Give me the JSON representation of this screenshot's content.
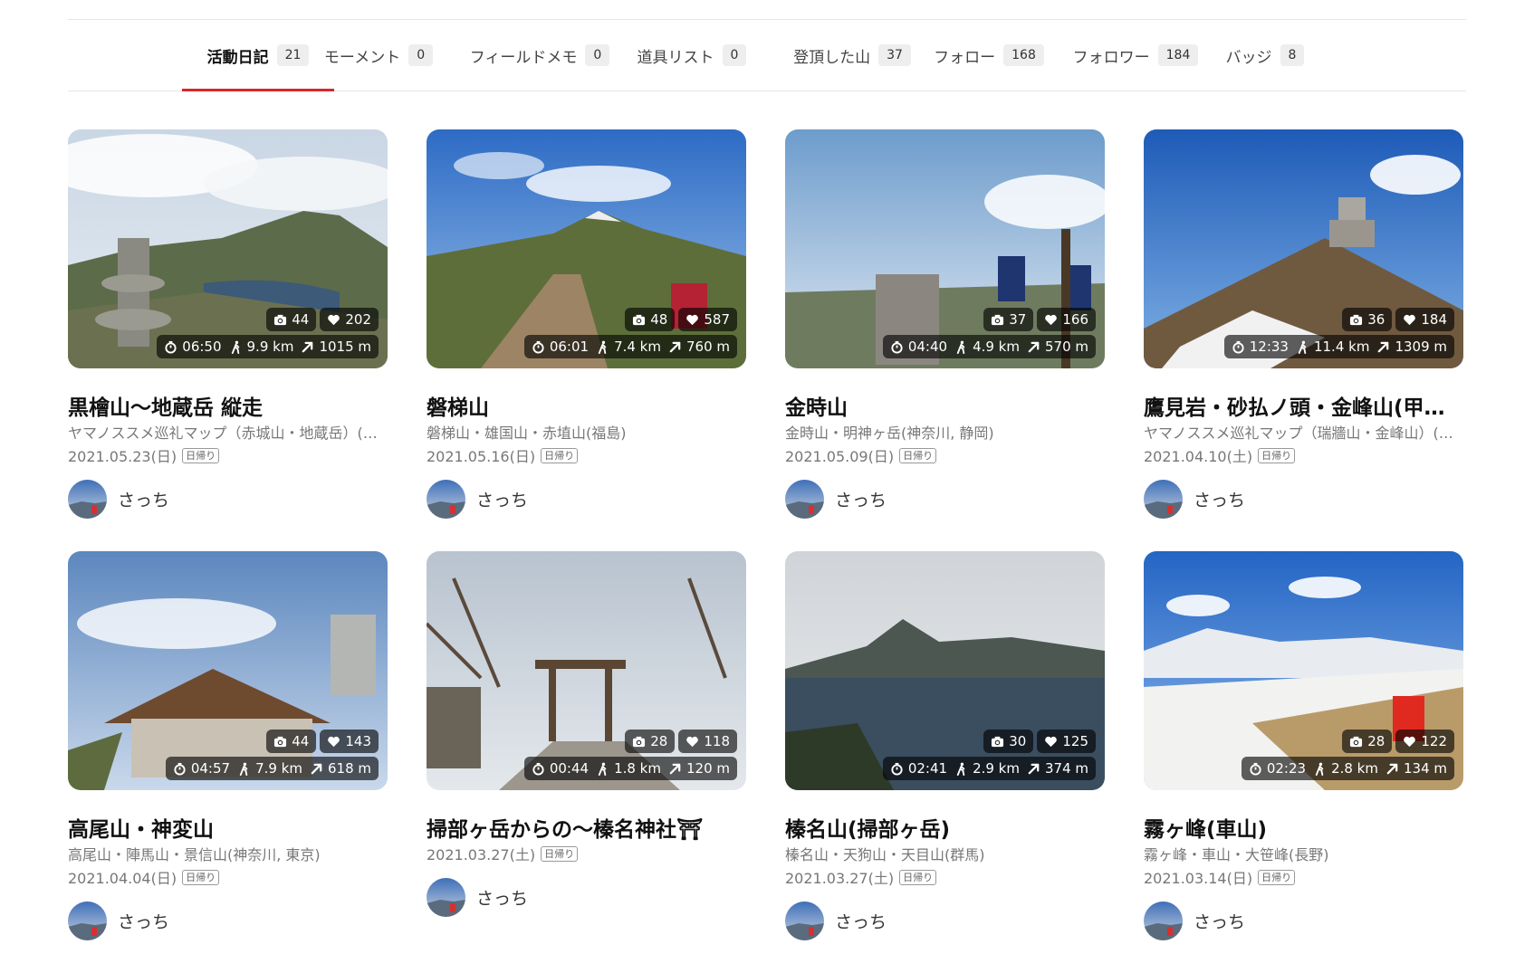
{
  "tabs": [
    {
      "label": "活動日記",
      "count": "21"
    },
    {
      "label": "モーメント",
      "count": "0"
    },
    {
      "label": "フィールドメモ",
      "count": "0"
    },
    {
      "label": "道具リスト",
      "count": "0"
    },
    {
      "label": "登頂した山",
      "count": "37"
    },
    {
      "label": "フォロー",
      "count": "168"
    },
    {
      "label": "フォロワー",
      "count": "184"
    },
    {
      "label": "バッジ",
      "count": "8"
    }
  ],
  "cards": [
    {
      "title": "黒檜山〜地蔵岳 縦走",
      "area": "ヤマノススメ巡礼マップ（赤城山・地蔵岳）(群馬)",
      "date": "2021.05.23(日)",
      "badge": "日帰り",
      "user": "さっち",
      "photos": "44",
      "likes": "202",
      "time": "06:50",
      "distance": "9.9 km",
      "elevation": "1015 m"
    },
    {
      "title": "磐梯山",
      "area": "磐梯山・雄国山・赤埴山(福島)",
      "date": "2021.05.16(日)",
      "badge": "日帰り",
      "user": "さっち",
      "photos": "48",
      "likes": "587",
      "time": "06:01",
      "distance": "7.4 km",
      "elevation": "760 m"
    },
    {
      "title": "金時山",
      "area": "金時山・明神ヶ岳(神奈川, 静岡)",
      "date": "2021.05.09(日)",
      "badge": "日帰り",
      "user": "さっち",
      "photos": "37",
      "likes": "166",
      "time": "04:40",
      "distance": "4.9 km",
      "elevation": "570 m"
    },
    {
      "title": "鷹見岩・砂払ノ頭・金峰山(甲州市)",
      "area": "ヤマノススメ巡礼マップ（瑞牆山・金峰山）(山梨)",
      "date": "2021.04.10(土)",
      "badge": "日帰り",
      "user": "さっち",
      "photos": "36",
      "likes": "184",
      "time": "12:33",
      "distance": "11.4 km",
      "elevation": "1309 m"
    },
    {
      "title": "高尾山・神変山",
      "area": "高尾山・陣馬山・景信山(神奈川, 東京)",
      "date": "2021.04.04(日)",
      "badge": "日帰り",
      "user": "さっち",
      "photos": "44",
      "likes": "143",
      "time": "04:57",
      "distance": "7.9 km",
      "elevation": "618 m"
    },
    {
      "title": "掃部ヶ岳からの〜榛名神社⛩",
      "area": "",
      "date": "2021.03.27(土)",
      "badge": "日帰り",
      "user": "さっち",
      "photos": "28",
      "likes": "118",
      "time": "00:44",
      "distance": "1.8 km",
      "elevation": "120 m"
    },
    {
      "title": "榛名山(掃部ヶ岳)",
      "area": "榛名山・天狗山・天目山(群馬)",
      "date": "2021.03.27(土)",
      "badge": "日帰り",
      "user": "さっち",
      "photos": "30",
      "likes": "125",
      "time": "02:41",
      "distance": "2.9 km",
      "elevation": "374 m"
    },
    {
      "title": "霧ヶ峰(車山)",
      "area": "霧ヶ峰・車山・大笹峰(長野)",
      "date": "2021.03.14(日)",
      "badge": "日帰り",
      "user": "さっち",
      "photos": "28",
      "likes": "122",
      "time": "02:23",
      "distance": "2.8 km",
      "elevation": "134 m"
    }
  ],
  "icons": {
    "photos": "camera-icon",
    "likes": "heart-icon",
    "time": "stopwatch-icon",
    "distance": "hiker-icon",
    "elevation": "arrow-up-right-icon"
  },
  "colors": {
    "accent": "#d9262b",
    "tab_count_bg": "#eeeeee",
    "stat_pill_bg": "rgba(0,0,0,0.62)"
  }
}
